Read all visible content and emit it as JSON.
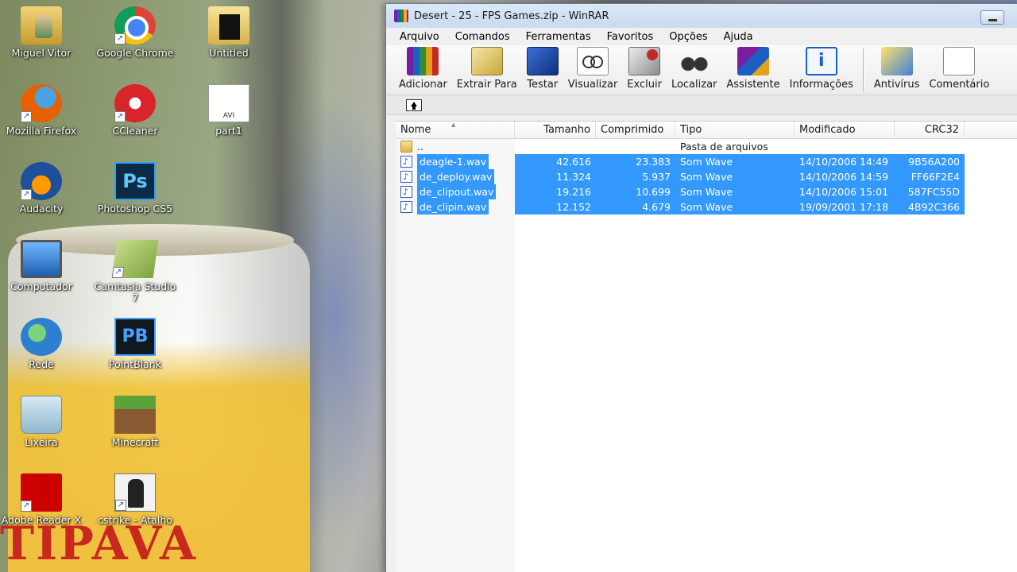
{
  "desktop": {
    "background_text": "TIPAVA",
    "icons": [
      {
        "label": "Miguel Vitor",
        "icon": "user-folder-icon"
      },
      {
        "label": "Google Chrome",
        "icon": "chrome-icon"
      },
      {
        "label": "Untitled",
        "icon": "folder-icon"
      },
      {
        "label": "Mozilla Firefox",
        "icon": "firefox-icon"
      },
      {
        "label": "CCleaner",
        "icon": "ccleaner-icon"
      },
      {
        "label": "part1",
        "icon": "avi-file-icon"
      },
      {
        "label": "Audacity",
        "icon": "audacity-icon"
      },
      {
        "label": "Photoshop CS5",
        "icon": "photoshop-icon",
        "glyph": "Ps"
      },
      {
        "label": "Computador",
        "icon": "computer-icon"
      },
      {
        "label": "Camtasia Studio 7",
        "icon": "camtasia-icon"
      },
      {
        "label": "Rede",
        "icon": "network-icon"
      },
      {
        "label": "PointBlank",
        "icon": "pointblank-icon",
        "glyph": "PB"
      },
      {
        "label": "Lixeira",
        "icon": "recycle-bin-icon"
      },
      {
        "label": "Minecraft",
        "icon": "minecraft-icon"
      },
      {
        "label": "Adobe Reader X",
        "icon": "adobe-reader-icon"
      },
      {
        "label": "cstrike - Atalho",
        "icon": "counter-strike-icon"
      }
    ]
  },
  "window": {
    "title": "Desert - 25 - FPS Games.zip - WinRAR",
    "menu": [
      "Arquivo",
      "Comandos",
      "Ferramentas",
      "Favoritos",
      "Opções",
      "Ajuda"
    ],
    "toolbar": [
      {
        "label": "Adicionar",
        "icon": "add-archive-icon"
      },
      {
        "label": "Extrair Para",
        "icon": "extract-icon"
      },
      {
        "label": "Testar",
        "icon": "test-icon"
      },
      {
        "label": "Visualizar",
        "icon": "view-icon"
      },
      {
        "label": "Excluir",
        "icon": "delete-icon"
      },
      {
        "label": "Localizar",
        "icon": "find-icon"
      },
      {
        "label": "Assistente",
        "icon": "wizard-icon"
      },
      {
        "label": "Informações",
        "icon": "info-icon"
      },
      {
        "label": "Antivírus",
        "icon": "antivirus-icon"
      },
      {
        "label": "Comentário",
        "icon": "comment-icon"
      }
    ],
    "columns": {
      "name": "Nome",
      "size": "Tamanho",
      "compressed": "Comprimido",
      "type": "Tipo",
      "modified": "Modificado",
      "crc": "CRC32"
    },
    "parent_row": {
      "name": "..",
      "type": "Pasta de arquivos"
    },
    "files": [
      {
        "name": "deagle-1.wav",
        "size": "42.616",
        "compressed": "23.383",
        "type": "Som Wave",
        "modified": "14/10/2006 14:49",
        "crc": "9B56A200"
      },
      {
        "name": "de_deploy.wav",
        "size": "11.324",
        "compressed": "5.937",
        "type": "Som Wave",
        "modified": "14/10/2006 14:59",
        "crc": "FF66F2E4"
      },
      {
        "name": "de_clipout.wav",
        "size": "19.216",
        "compressed": "10.699",
        "type": "Som Wave",
        "modified": "14/10/2006 15:01",
        "crc": "587FC55D"
      },
      {
        "name": "de_clipin.wav",
        "size": "12.152",
        "compressed": "4.679",
        "type": "Som Wave",
        "modified": "19/09/2001 17:18",
        "crc": "4B92C366"
      }
    ],
    "selection_color": "#3399ff"
  }
}
